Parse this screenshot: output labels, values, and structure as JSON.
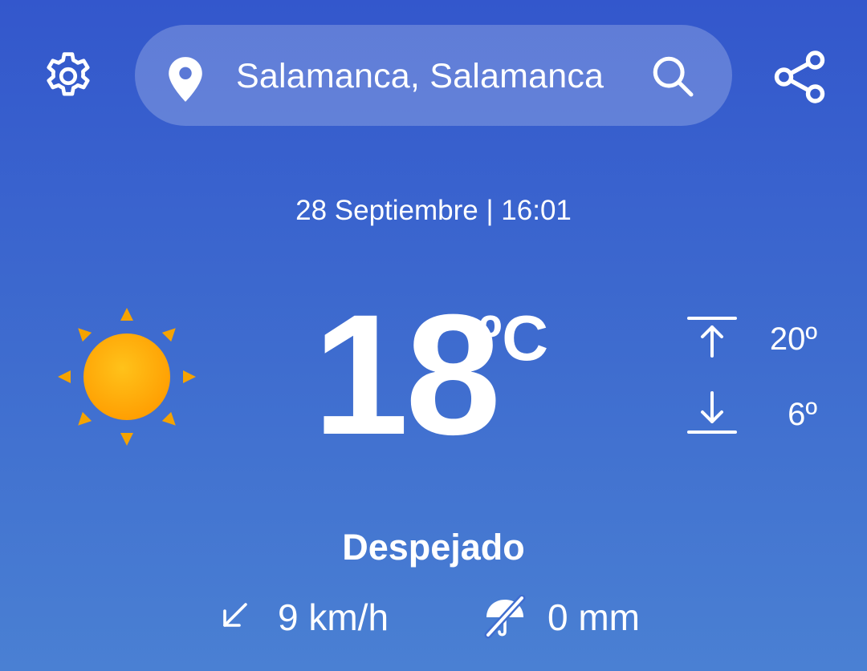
{
  "header": {
    "location": "Salamanca, Salamanca",
    "icons": {
      "settings": "gear-icon",
      "location": "map-pin-icon",
      "search": "search-icon",
      "share": "share-icon"
    }
  },
  "current": {
    "datetime": "28 Septiembre | 16:01",
    "temperature": "18",
    "unit": "ºC",
    "max": "20º",
    "min": "6º",
    "condition": "Despejado",
    "condition_icon": "sun-icon",
    "wind": "9 km/h",
    "wind_icon": "wind-direction-arrow-icon",
    "precipitation": "0 mm",
    "precipitation_icon": "no-rain-umbrella-icon"
  },
  "colors": {
    "background_top": "#3357cc",
    "background_bottom": "#4a80d3",
    "sun": "#ffa400",
    "sun_rays": "#f5a300",
    "text": "#ffffff"
  }
}
